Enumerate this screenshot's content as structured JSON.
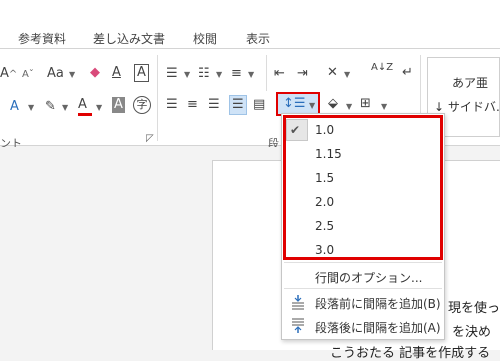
{
  "tabs": [
    "参考資料",
    "差し込み文書",
    "校閲",
    "表示"
  ],
  "ribbon": {
    "font_group_label": "ント",
    "paragraph_group_label": "段",
    "styles_sample": "あア亜",
    "styles_name": "↓ サイドバ…",
    "font_case": "Aa",
    "font_size_up": "A",
    "font_size_down": "A",
    "clear_format": "A",
    "text_box_char": "A",
    "text_effect": "A",
    "font_color": "A",
    "char_shade": "A",
    "enclosed_char": "字",
    "sort": "A↓Z"
  },
  "line_spacing_menu": {
    "options": [
      "1.0",
      "1.15",
      "1.5",
      "2.0",
      "2.5",
      "3.0"
    ],
    "selected": "1.0",
    "line_options_label": "行間のオプション...",
    "add_before_label": "段落前に間隔を追加(B)",
    "add_after_label": "段落後に間隔を追加(A)"
  },
  "document": {
    "line1": "現を使っ",
    "line2": "を決め",
    "line3": "こうおたる 記事を作成する"
  },
  "colors": {
    "accent_red": "#e00000",
    "font_color_bar": "#e00000",
    "text_effect_blue": "#2a6ebb",
    "highlight_blue": "#cfe3f7"
  }
}
